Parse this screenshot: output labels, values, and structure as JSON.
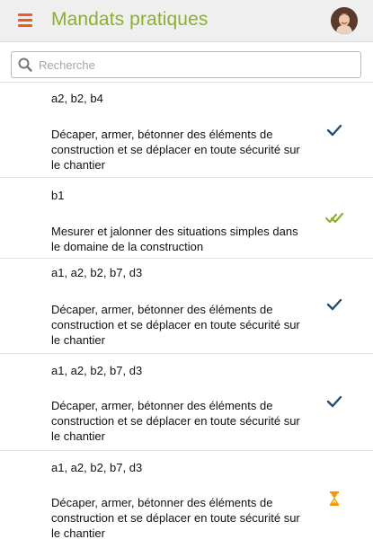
{
  "header": {
    "title": "Mandats pratiques"
  },
  "search": {
    "placeholder": "Recherche",
    "value": ""
  },
  "colors": {
    "accent_green": "#8bb12c",
    "menu_orange": "#f05a1e",
    "check_blue": "#1f4e79",
    "check_green": "#8bb12c",
    "pending_orange": "#f29a00"
  },
  "mandates": [
    {
      "codes": "a2, b2, b4",
      "description": "Décaper, armer, bétonner des éléments de construction et se déplacer en toute sécurité sur le chantier",
      "status_icon": "checkmark-icon"
    },
    {
      "codes": "b1",
      "description": "Mesurer et jalonner des situations simples dans le domaine de la construction",
      "status_icon": "double-checkmark-icon"
    },
    {
      "codes": "a1, a2, b2, b7, d3",
      "description": "Décaper, armer, bétonner des éléments de construction et se déplacer en toute sécurité sur le chantier",
      "status_icon": "checkmark-icon"
    },
    {
      "codes": "a1, a2, b2, b7, d3",
      "description": "Décaper, armer, bétonner des éléments de construction et se déplacer en toute sécurité sur le chantier",
      "status_icon": "checkmark-icon"
    },
    {
      "codes": "a1, a2, b2, b7, d3",
      "description": "Décaper, armer, bétonner des éléments de construction et se déplacer en toute sécurité sur le chantier",
      "status_icon": "hourglass-icon"
    }
  ]
}
